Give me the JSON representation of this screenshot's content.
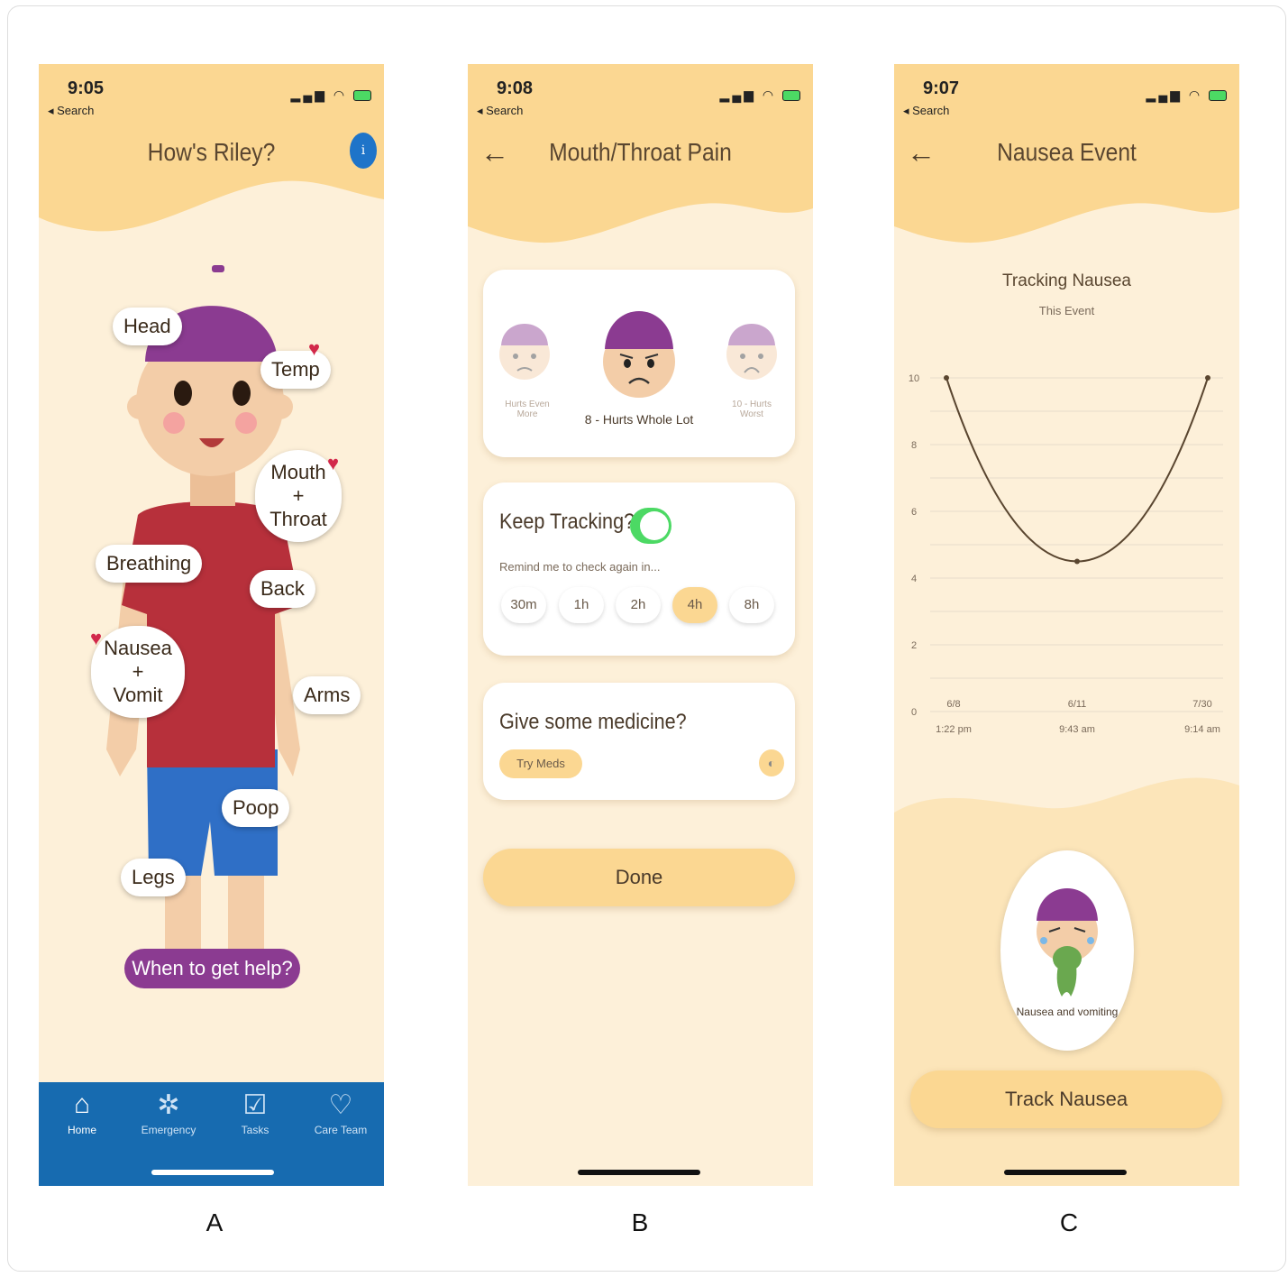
{
  "panels": {
    "a": {
      "letter": "A",
      "status": {
        "time": "9:05",
        "back": "◂ Search"
      },
      "title": "How's Riley?",
      "info": "i",
      "body_parts": {
        "head": "Head",
        "temp": "Temp",
        "mouth": "Mouth",
        "mouth_plus": "+",
        "throat": "Throat",
        "breathing": "Breathing",
        "back": "Back",
        "nausea": "Nausea",
        "nausea_plus": "+",
        "vomit": "Vomit",
        "arms": "Arms",
        "poop": "Poop",
        "legs": "Legs"
      },
      "help_button": "When to get help?",
      "tabs": [
        {
          "label": "Home",
          "icon": "home-icon"
        },
        {
          "label": "Emergency",
          "icon": "siren-icon"
        },
        {
          "label": "Tasks",
          "icon": "clipboard-icon"
        },
        {
          "label": "Care Team",
          "icon": "stethoscope-icon"
        }
      ]
    },
    "b": {
      "letter": "B",
      "status": {
        "time": "9:08",
        "back": "◂ Search"
      },
      "title": "Mouth/Throat Pain",
      "faces": {
        "left_caption": "Hurts Even More",
        "main_caption": "8 - Hurts Whole Lot",
        "right_caption": "10 - Hurts Worst"
      },
      "tracking": {
        "heading": "Keep Tracking?",
        "toggle_on": true,
        "remind_text": "Remind me to check again in...",
        "intervals": [
          "30m",
          "1h",
          "2h",
          "4h",
          "8h"
        ],
        "selected": "4h"
      },
      "medicine": {
        "heading": "Give some medicine?",
        "button": "Try Meds"
      },
      "done": "Done"
    },
    "c": {
      "letter": "C",
      "status": {
        "time": "9:07",
        "back": "◂ Search"
      },
      "title": "Nausea Event",
      "track_button": "Track Nausea",
      "nausea_label": "Nausea and vomiting"
    }
  },
  "colors": {
    "header": "#fbd792",
    "background": "#fdf0d9",
    "tabbar": "#176bb0",
    "help": "#8b3b91",
    "toggle": "#4cd964",
    "heart": "#d2284a"
  },
  "chart_data": {
    "type": "line",
    "title": "Tracking Nausea",
    "subtitle": "This Event",
    "y_ticks": [
      "0",
      "2",
      "4",
      "6",
      "8",
      "10"
    ],
    "ylim": [
      0,
      10
    ],
    "x_labels": [
      {
        "date": "6/8",
        "time": "1:22 pm"
      },
      {
        "date": "6/11",
        "time": "9:43 am"
      },
      {
        "date": "7/30",
        "time": "9:14 am"
      }
    ],
    "values": [
      10,
      4.5,
      10
    ],
    "grid": true
  }
}
